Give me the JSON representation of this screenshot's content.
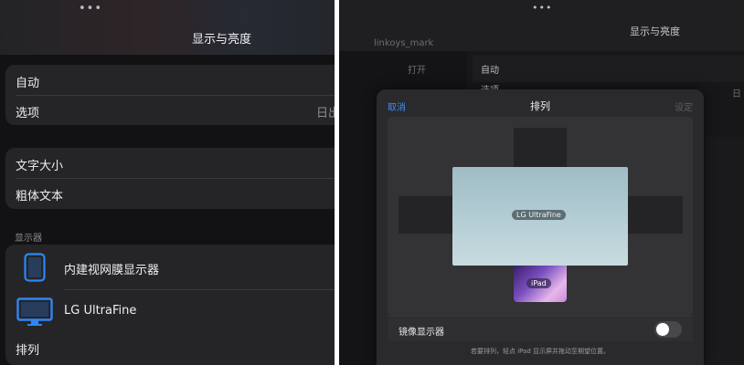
{
  "left": {
    "more_dots": "•••",
    "title": "显示与亮度",
    "rows_group1": [
      {
        "label": "自动"
      },
      {
        "label": "选项",
        "value": "日出"
      }
    ],
    "rows_group2": [
      {
        "label": "文字大小"
      },
      {
        "label": "粗体文本"
      }
    ],
    "displays_section": "显示器",
    "displays": [
      {
        "label": "内建视网膜显示器",
        "icon": "ipad-icon"
      },
      {
        "label": "LG UltraFine",
        "icon": "monitor-icon"
      }
    ],
    "arrange_label": "排列",
    "accent_color": "#2f86f5"
  },
  "right": {
    "more_dots": "•••",
    "background_title": "显示与亮度",
    "background_texts": [
      "linkoys_mark",
      "打开",
      "自动",
      "选项",
      "日"
    ],
    "sheet": {
      "cancel": "取消",
      "title": "排列",
      "done": "设定",
      "main_display_label": "LG UltraFine",
      "ipad_label": "iPad",
      "mirror_label": "镜像显示器",
      "mirror_on": false,
      "hint": "若要排列，轻点 iPad 显示屏并拖动至期望位置。"
    }
  }
}
